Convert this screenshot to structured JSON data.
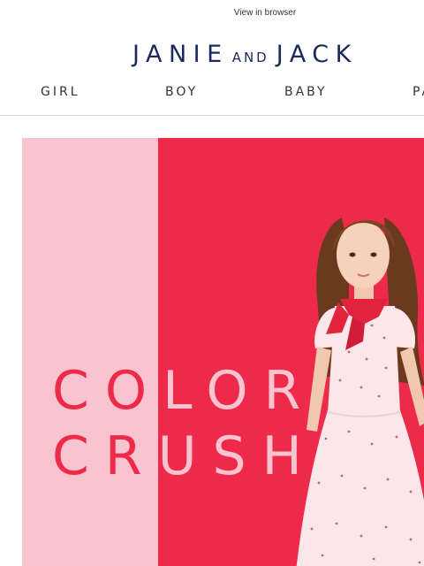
{
  "header": {
    "view_in_browser": "View in browser"
  },
  "logo": {
    "part1": "JANIE",
    "part2": "AND",
    "part3": "JACK"
  },
  "nav": {
    "items": [
      {
        "label": "GIRL"
      },
      {
        "label": "BOY"
      },
      {
        "label": "BABY"
      },
      {
        "label": "PA"
      }
    ]
  },
  "hero": {
    "title_line1": {
      "left": "CO",
      "right": "LOR"
    },
    "title_line2": {
      "left": "CR",
      "right": "USH"
    }
  },
  "colors": {
    "brand_navy": "#1b2a5c",
    "hero_red": "#ee2a4b",
    "hero_pink": "#f9c3d0"
  }
}
